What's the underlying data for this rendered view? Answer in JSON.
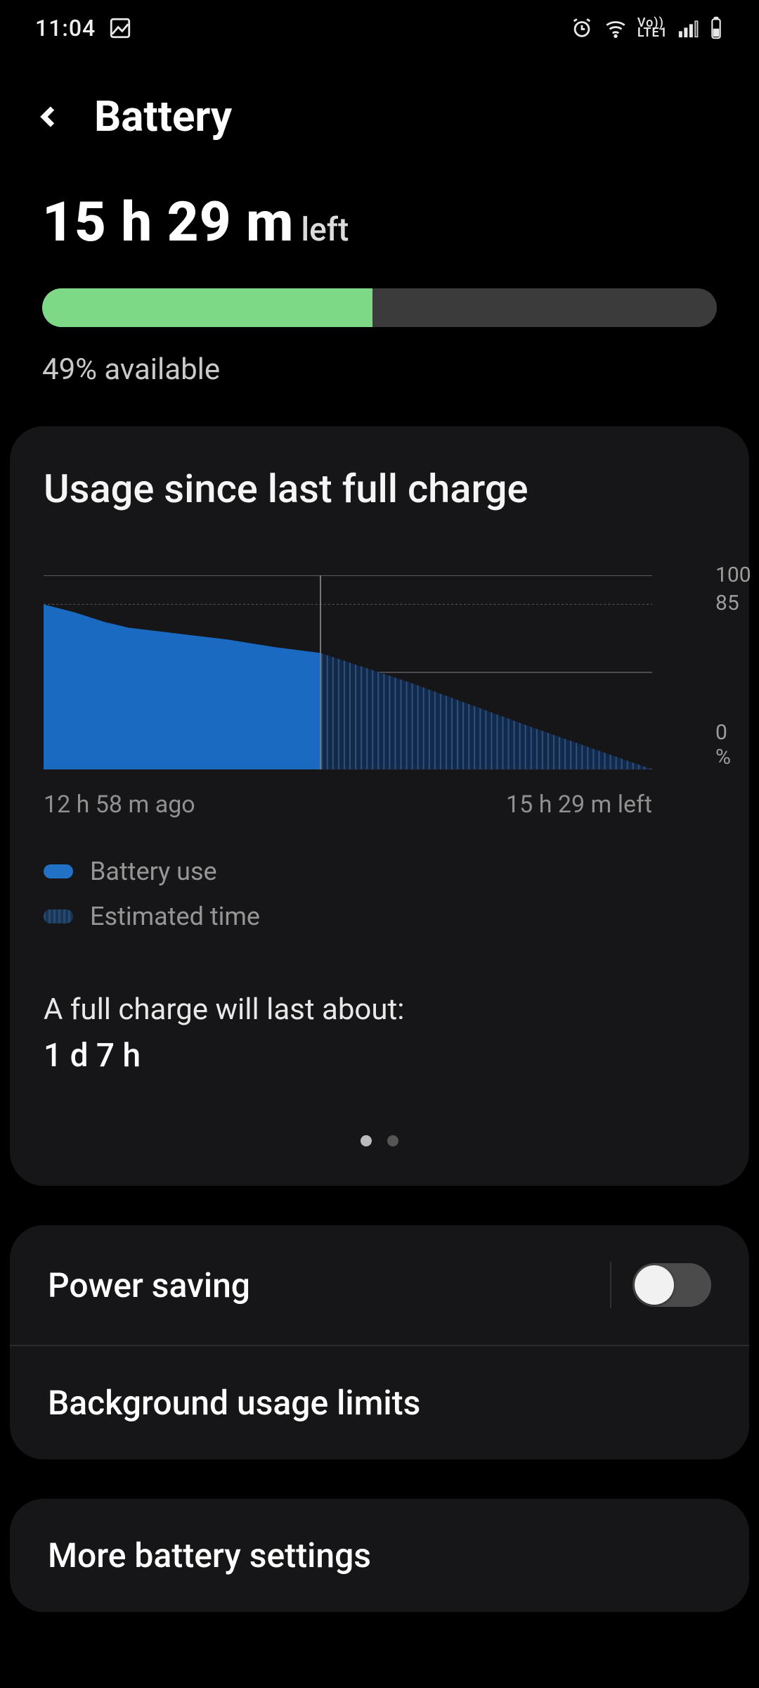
{
  "status": {
    "time": "11:04",
    "lte_label": "LTE1",
    "vo_label": "Vo))"
  },
  "header": {
    "title": "Battery"
  },
  "summary": {
    "time_left_value": "15 h 29 m",
    "time_left_suffix": "left",
    "percent_fill": 49,
    "percent_text": "49% available"
  },
  "usage_card": {
    "title": "Usage since last full charge",
    "x_start": "12 h 58 m ago",
    "x_end": "15 h 29 m left",
    "legend_solid": "Battery use",
    "legend_hatch": "Estimated time",
    "full_charge_label": "A full charge will last about:",
    "full_charge_value": "1 d 7 h"
  },
  "items": {
    "power_saving": "Power saving",
    "bg_limits": "Background usage limits",
    "more": "More battery settings",
    "power_saving_on": false
  },
  "chart_data": {
    "type": "area",
    "ylim": [
      0,
      100
    ],
    "grid_level": 85,
    "history_fraction_x": 0.455,
    "x_categories_note": "x spans from 12h58m ago (0) to 15h29m ahead (1)",
    "series": [
      {
        "name": "Battery use",
        "style": "solid",
        "points": [
          {
            "x": 0.0,
            "y": 85
          },
          {
            "x": 0.05,
            "y": 81
          },
          {
            "x": 0.1,
            "y": 76
          },
          {
            "x": 0.14,
            "y": 73
          },
          {
            "x": 0.22,
            "y": 70
          },
          {
            "x": 0.3,
            "y": 67
          },
          {
            "x": 0.38,
            "y": 63
          },
          {
            "x": 0.455,
            "y": 60
          }
        ]
      },
      {
        "name": "Estimated time",
        "style": "hatched",
        "points": [
          {
            "x": 0.455,
            "y": 60
          },
          {
            "x": 0.6,
            "y": 45
          },
          {
            "x": 0.8,
            "y": 22
          },
          {
            "x": 1.0,
            "y": 0
          }
        ]
      }
    ],
    "ytick_labels": [
      "100",
      "85",
      "0 %"
    ]
  }
}
